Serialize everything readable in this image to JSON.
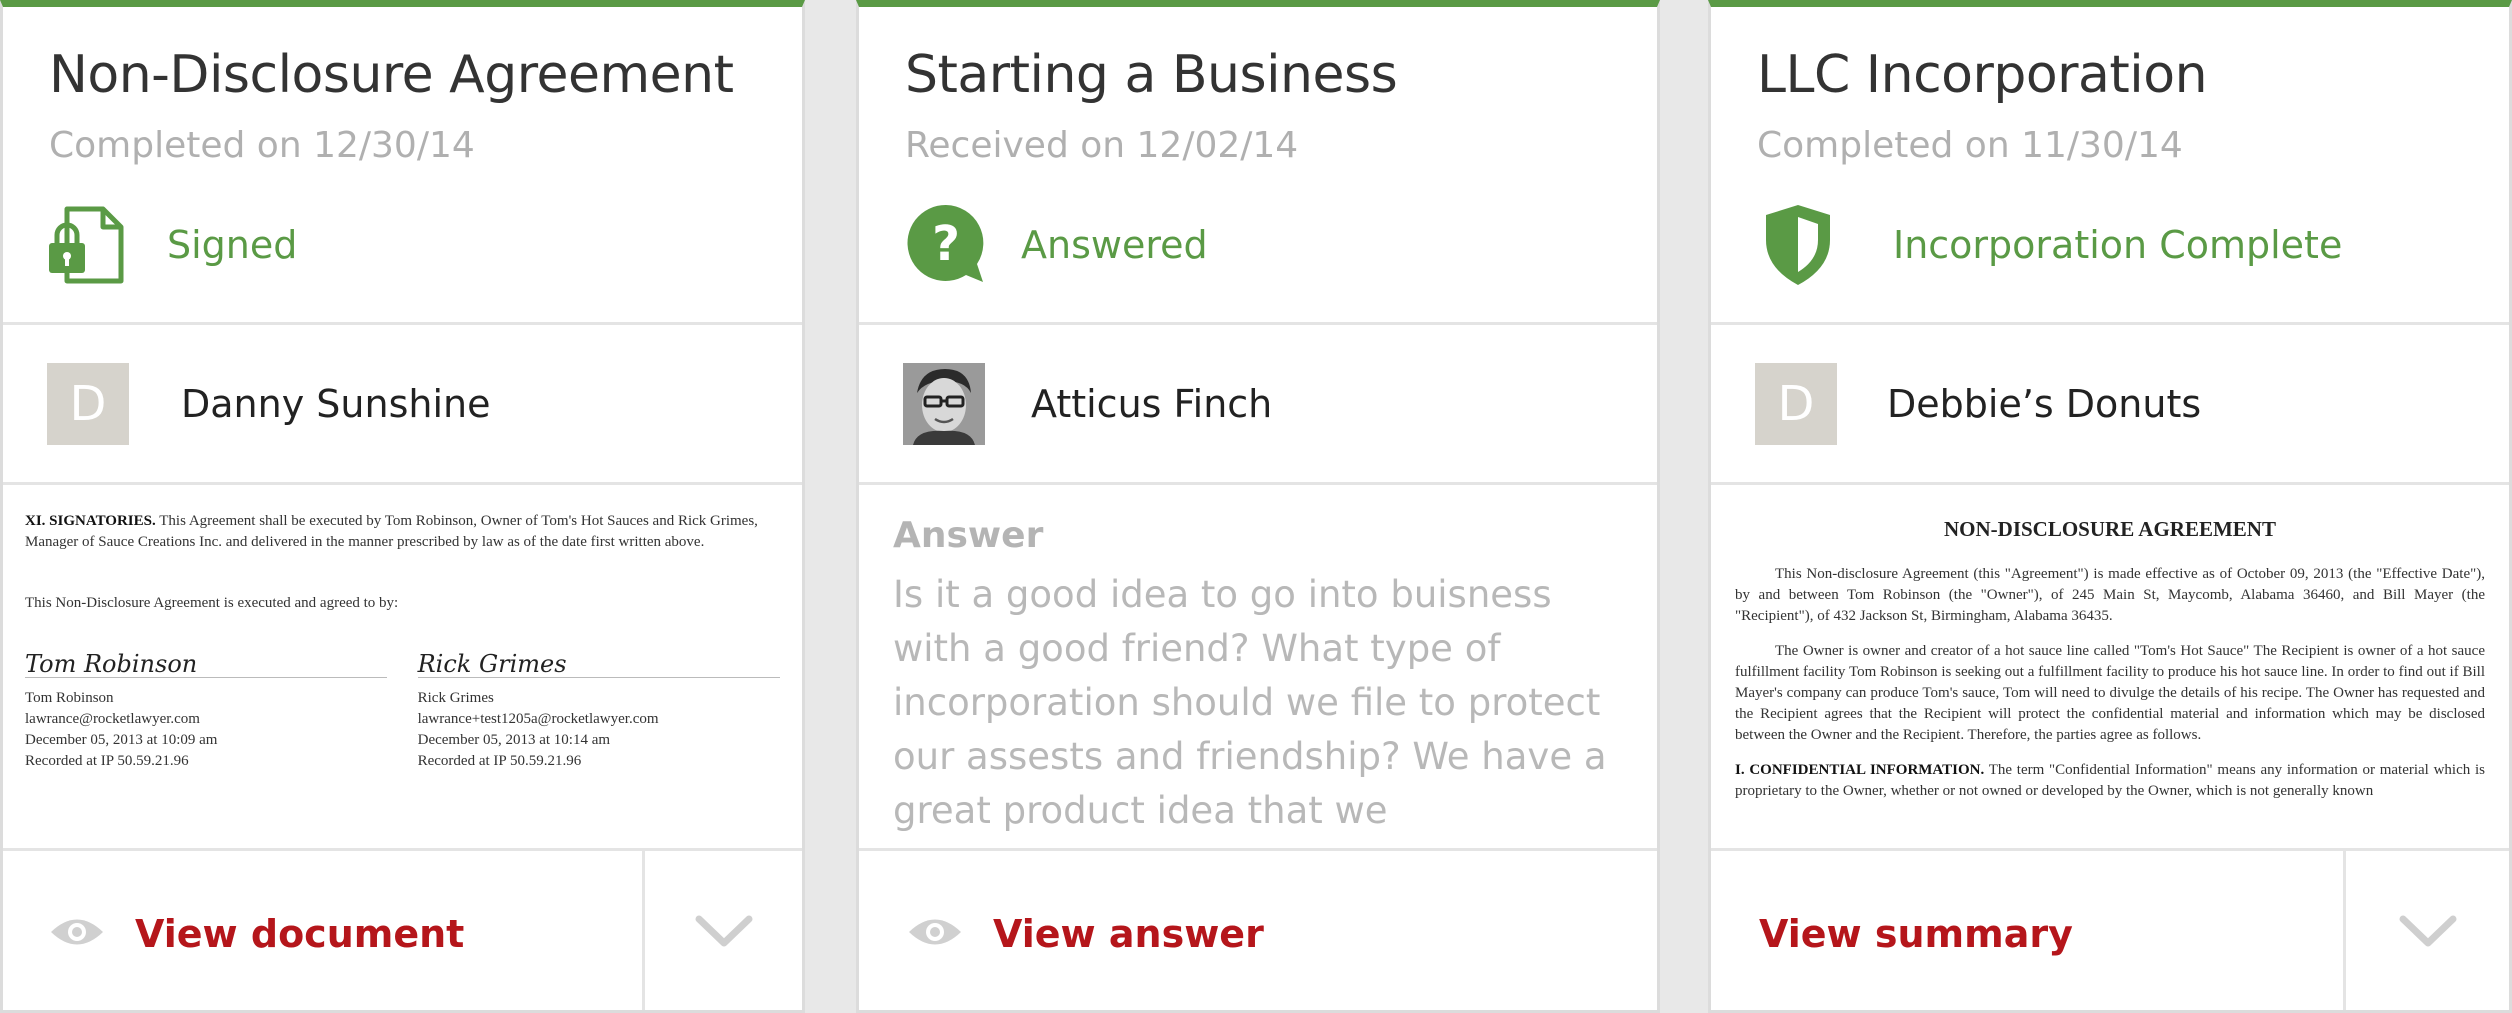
{
  "colors": {
    "accent_green": "#5a9a45",
    "link_red": "#b5161b",
    "muted": "#b0b0b0"
  },
  "cards": [
    {
      "title": "Non-Disclosure Agreement",
      "subtitle": "Completed on 12/30/14",
      "status": "Signed",
      "status_icon": "locked-document-icon",
      "person_initial": "D",
      "person_name": "Danny Sunshine",
      "doc": {
        "p1_heading": "XI. SIGNATORIES.",
        "p1_body": "This Agreement shall be executed by Tom Robinson, Owner of Tom's Hot Sauces and Rick Grimes, Manager of Sauce Creations Inc. and delivered in the manner prescribed by law as of the date first written above.",
        "p2": "This Non-Disclosure Agreement is executed and agreed to by:",
        "sig1": {
          "script": "Tom Robinson",
          "name": "Tom Robinson",
          "email": "lawrance@rocketlawyer.com",
          "date": "December 05, 2013 at 10:09 am",
          "ip": "Recorded at IP 50.59.21.96"
        },
        "sig2": {
          "script": "Rick Grimes",
          "name": "Rick Grimes",
          "email": "lawrance+test1205a@rocketlawyer.com",
          "date": "December 05, 2013 at 10:14 am",
          "ip": "Recorded at IP 50.59.21.96"
        }
      },
      "action": "View document"
    },
    {
      "title": "Starting a Business",
      "subtitle": "Received on 12/02/14",
      "status": "Answered",
      "status_icon": "question-bubble-icon",
      "person_name": "Atticus Finch",
      "answer_label": "Answer",
      "answer_text": "Is it a good idea to go into buisness with a good friend? What type of incorporation should we file to protect our assests and friendship? We have a great product idea that we collaboratively came up with a...",
      "action": "View answer"
    },
    {
      "title": "LLC Incorporation",
      "subtitle": "Completed on 11/30/14",
      "status": "Incorporation Complete",
      "status_icon": "shield-icon",
      "person_initial": "D",
      "person_name": "Debbie’s Donuts",
      "doc": {
        "heading": "NON-DISCLOSURE AGREEMENT",
        "p1": "This Non-disclosure Agreement (this \"Agreement\") is made effective as of October 09, 2013 (the \"Effective Date\"), by and between Tom Robinson (the \"Owner\"), of 245 Main St, Maycomb, Alabama 36460, and Bill Mayer (the \"Recipient\"), of 432 Jackson St, Birmingham, Alabama 36435.",
        "p2": "The Owner is owner and creator of a hot sauce line called \"Tom's Hot Sauce\" The Recipient is owner of a hot sauce fulfillment facility Tom Robinson is seeking out a fulfillment facility to produce his hot sauce line. In order to find out if Bill Mayer's company can produce Tom's sauce, Tom will need to divulge the details of his recipe. The Owner has requested and the Recipient agrees that the Recipient will protect the confidential material and information which may be disclosed between the Owner and the Recipient. Therefore, the parties agree as follows.",
        "p3_heading": "I. CONFIDENTIAL INFORMATION.",
        "p3_body": "The term \"Confidential Information\" means any information or material which is proprietary to the Owner, whether or not owned or developed by the Owner, which is not generally known"
      },
      "action": "View summary"
    }
  ]
}
